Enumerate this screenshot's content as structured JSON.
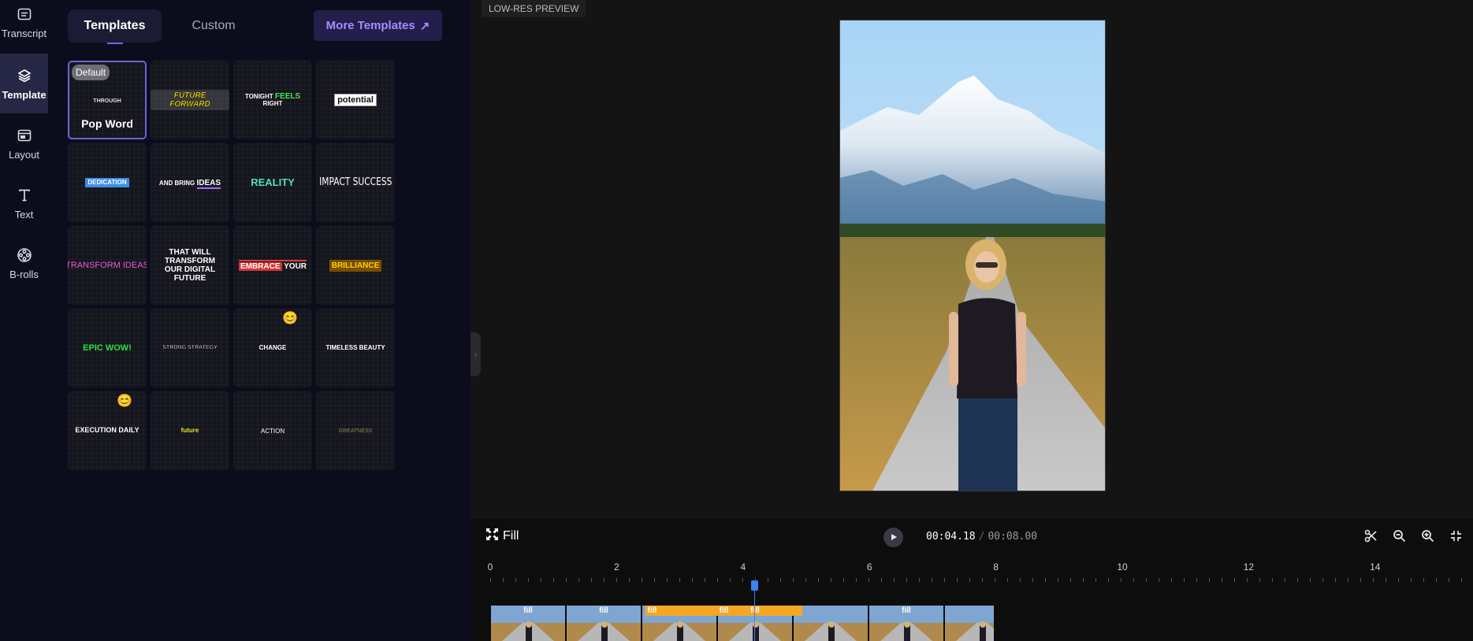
{
  "sidebar": {
    "items": [
      {
        "label": "Transcript"
      },
      {
        "label": "Template"
      },
      {
        "label": "Layout"
      },
      {
        "label": "Text"
      },
      {
        "label": "B-rolls"
      }
    ]
  },
  "panel": {
    "tabs": [
      {
        "label": "Templates"
      },
      {
        "label": "Custom"
      }
    ],
    "more_templates": "More Templates",
    "more_icon": "↗",
    "default_badge": "Default",
    "tiles": {
      "pop_word": {
        "sample": "THROUGH",
        "name": "Pop Word"
      },
      "future_forward": "FUTURE FORWARD",
      "tonight_a": "TONIGHT",
      "tonight_b": "FEELS",
      "tonight_c": "RIGHT",
      "potential": "potential",
      "dedication": "DEDICATION",
      "and_bring": "AND BRING",
      "ideas": "IDEAS",
      "reality": "REALITY",
      "impact": "IMPACT SUCCESS",
      "transform_ideas": "TRANSFORM IDEAS",
      "that_will": "THAT WILL TRANSFORM OUR DIGITAL FUTURE",
      "embrace": "EMBRACE",
      "your": "YOUR",
      "brilliance": "BRILLIANCE",
      "epic": "EPIC WOW!",
      "strong": "STRONG STRATEGY",
      "change": "CHANGE",
      "change_emoji": "😊",
      "timeless": "TIMELESS BEAUTY",
      "execution": "EXECUTION DAILY",
      "execution_emoji": "😊",
      "future": "future",
      "action": "ACTION",
      "greatness": "GREATNESS"
    }
  },
  "preview": {
    "badge": "LOW-RES PREVIEW"
  },
  "timeline": {
    "fill_label": "Fill",
    "current_time": "00:04.18",
    "separator": "/",
    "total_time": "00:08.00",
    "ruler_labels": [
      "0",
      "2",
      "4",
      "6",
      "8",
      "10",
      "12",
      "14"
    ],
    "clip_label": "fill",
    "playhead_seconds": 4.18
  },
  "colors": {
    "accent": "#7c5cff",
    "highlight": "#f5a623",
    "playhead": "#3b82f6"
  }
}
